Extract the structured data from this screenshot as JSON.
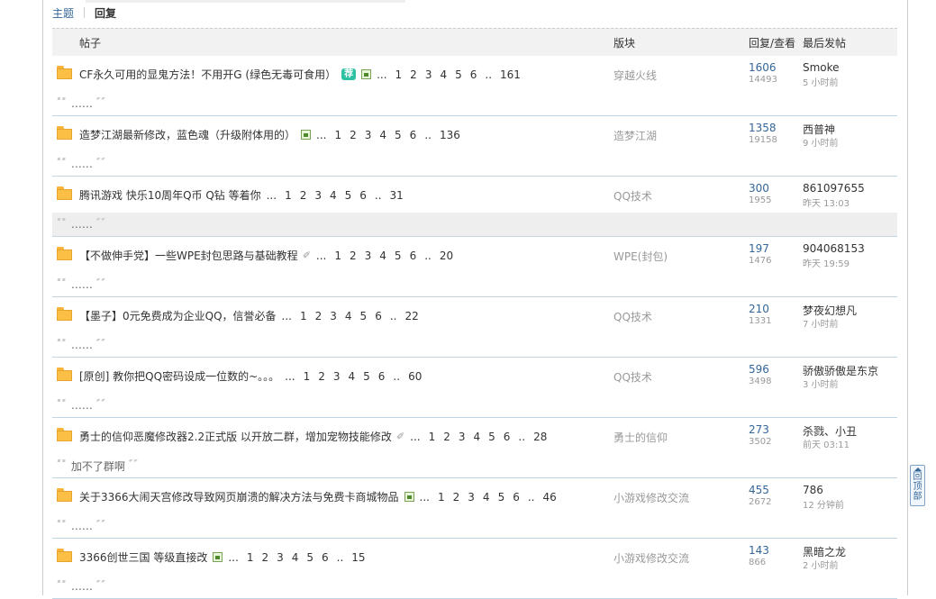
{
  "tabs": {
    "topics": "主题",
    "replies": "回复"
  },
  "table_header": {
    "post": "帖子",
    "forum": "版块",
    "reply_view": "回复/查看",
    "last_post": "最后发帖"
  },
  "quote_text": "……",
  "back_to_top": "回顶部",
  "rows": [
    {
      "title": "CF永久可用的显鬼方法！不用开G (绿色无毒可食用）",
      "badge": "荐",
      "img": true,
      "clip": false,
      "pages": [
        "1",
        "2",
        "3",
        "4",
        "5",
        "6",
        "..",
        "161"
      ],
      "forum": "穿越火线",
      "replies": "1606",
      "views": "14493",
      "last_user": "Smoke",
      "last_time": "5 小时前",
      "quote": "……",
      "alt": false
    },
    {
      "title": "造梦江湖最新修改，蓝色魂（升级附体用的）",
      "badge": "",
      "img": true,
      "clip": false,
      "pages": [
        "1",
        "2",
        "3",
        "4",
        "5",
        "6",
        "..",
        "136"
      ],
      "forum": "造梦江湖",
      "replies": "1358",
      "views": "19158",
      "last_user": "西普神",
      "last_time": "9 小时前",
      "quote": "……",
      "alt": false
    },
    {
      "title": "腾讯游戏 快乐10周年Q币 Q钻 等着你",
      "badge": "",
      "img": false,
      "clip": false,
      "pages": [
        "1",
        "2",
        "3",
        "4",
        "5",
        "6",
        "..",
        "31"
      ],
      "forum": "QQ技术",
      "replies": "300",
      "views": "1955",
      "last_user": "861097655",
      "last_time": "昨天 13:03",
      "quote": "……",
      "alt": true
    },
    {
      "title": "【不做伸手党】一些WPE封包思路与基础教程",
      "badge": "",
      "img": false,
      "clip": true,
      "pages": [
        "1",
        "2",
        "3",
        "4",
        "5",
        "6",
        "..",
        "20"
      ],
      "forum": "WPE(封包)",
      "replies": "197",
      "views": "1476",
      "last_user": "904068153",
      "last_time": "昨天 19:59",
      "quote": "……",
      "alt": false
    },
    {
      "title": "【墨子】0元免费成为企业QQ，信誉必备",
      "badge": "",
      "img": false,
      "clip": false,
      "pages": [
        "1",
        "2",
        "3",
        "4",
        "5",
        "6",
        "..",
        "22"
      ],
      "forum": "QQ技术",
      "replies": "210",
      "views": "1331",
      "last_user": "梦夜幻想凡",
      "last_time": "7 小时前",
      "quote": "……",
      "alt": false
    },
    {
      "title": "[原创] 教你把QQ密码设成一位数的~。。。",
      "badge": "",
      "img": false,
      "clip": false,
      "pages": [
        "1",
        "2",
        "3",
        "4",
        "5",
        "6",
        "..",
        "60"
      ],
      "forum": "QQ技术",
      "replies": "596",
      "views": "3498",
      "last_user": "骄傲骄傲是东京",
      "last_time": "3 小时前",
      "quote": "……",
      "alt": false
    },
    {
      "title": "勇士的信仰恶魔修改器2.2正式版 以开放二群，增加宠物技能修改",
      "badge": "",
      "img": false,
      "clip": true,
      "pages": [
        "1",
        "2",
        "3",
        "4",
        "5",
        "6",
        "..",
        "28"
      ],
      "forum": "勇士的信仰",
      "replies": "273",
      "views": "3502",
      "last_user": "杀戮、小丑",
      "last_time": "前天 03:11",
      "quote": "加不了群啊",
      "alt": false
    },
    {
      "title": "关于3366大闹天宫修改导致网页崩溃的解决方法与免费卡商城物品",
      "badge": "",
      "img": true,
      "clip": false,
      "pages": [
        "1",
        "2",
        "3",
        "4",
        "5",
        "6",
        "..",
        "46"
      ],
      "forum": "小游戏修改交流",
      "replies": "455",
      "views": "2672",
      "last_user": "786",
      "last_time": "12 分钟前",
      "quote": "……",
      "alt": false
    },
    {
      "title": "3366创世三国 等级直接改",
      "badge": "",
      "img": true,
      "clip": false,
      "pages": [
        "1",
        "2",
        "3",
        "4",
        "5",
        "6",
        "..",
        "15"
      ],
      "forum": "小游戏修改交流",
      "replies": "143",
      "views": "866",
      "last_user": "黑暗之龙",
      "last_time": "2 小时前",
      "quote": "……",
      "alt": false
    }
  ]
}
